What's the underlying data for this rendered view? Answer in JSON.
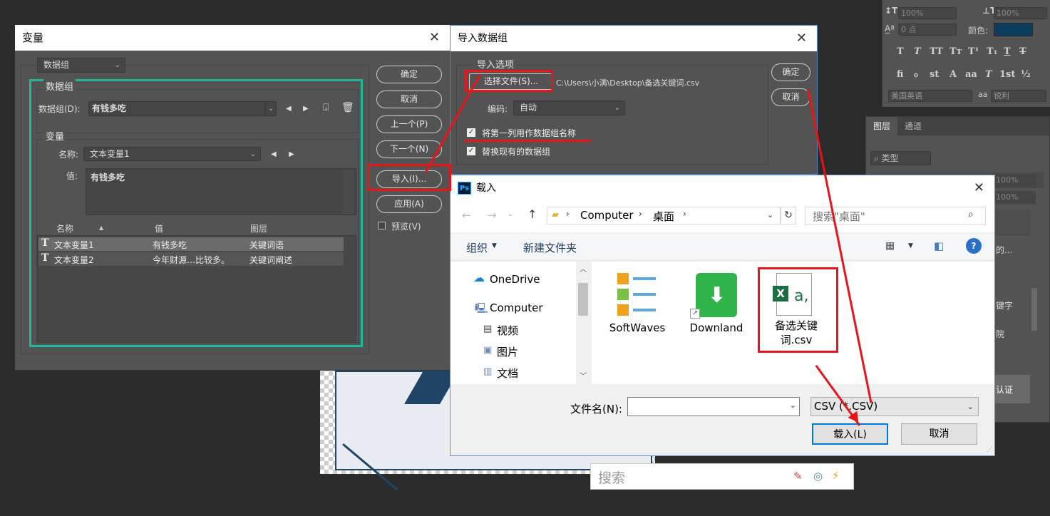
{
  "ps_char_panel": {
    "leading_value": "100%",
    "tracking_value": "100%",
    "baseline_value": "0 点",
    "color_label": "颜色:",
    "language": "美国英语",
    "aa_label": "aa",
    "aa_value": "锐利",
    "color_swatch": "#0a3d5e"
  },
  "ps_layers_panel": {
    "tab_layers": "图层",
    "tab_channels": "通道",
    "filter_label": "类型",
    "opacity1": "100%",
    "opacity2": "100%",
    "layer_frag1": "的...",
    "layer_frag2": "键字",
    "layer_frag3": "院",
    "layer_frag4": "认证"
  },
  "bottom_search_placeholder": "搜索",
  "variables_dialog": {
    "title": "变量",
    "mode_select": "数据组",
    "dataset_group_label": "数据组",
    "dataset_label": "数据组(D):",
    "dataset_value": "有钱多吃",
    "variables_group_label": "变量",
    "name_label": "名称:",
    "name_value": "文本变量1",
    "value_label": "值:",
    "value_text": "有钱多吃",
    "table_headers": [
      "名称",
      "值",
      "图层"
    ],
    "rows": [
      {
        "name": "文本变量1",
        "value": "有钱多吃",
        "layer": "关键词语"
      },
      {
        "name": "文本变量2",
        "value": "今年财源…比较多。",
        "layer": "关键词阐述"
      }
    ],
    "btn_ok": "确定",
    "btn_cancel": "取消",
    "btn_prev": "上一个(P)",
    "btn_next": "下一个(N)",
    "btn_import": "导入(I)...",
    "btn_apply": "应用(A)",
    "preview_label": "预览(V)"
  },
  "import_dialog": {
    "title": "导入数据组",
    "options_label": "导入选项",
    "choose_file_btn": "选择文件(S)...",
    "file_path": "C:\\Users\\小满\\Desktop\\备选关键词.csv",
    "encoding_label": "编码:",
    "encoding_value": "自动",
    "check1_label": "将第一列用作数据组名称",
    "check2_label": "替换现有的数据组",
    "btn_ok": "确定",
    "btn_cancel": "取消"
  },
  "load_dialog": {
    "title": "载入",
    "app_badge": "Ps",
    "breadcrumb": [
      "Computer",
      "桌面"
    ],
    "search_placeholder": "搜索\"桌面\"",
    "organize": "组织",
    "new_folder": "新建文件夹",
    "nav_items": [
      "OneDrive",
      "Computer",
      "视频",
      "图片",
      "文档"
    ],
    "files": [
      {
        "name": "SoftWaves"
      },
      {
        "name": "Downland"
      },
      {
        "name": "备选关键词.csv",
        "badge": "X"
      }
    ],
    "filename_label": "文件名(N):",
    "filename_value": "",
    "filetype_value": "CSV (*.CSV)",
    "btn_load": "载入(L)",
    "btn_cancel": "取消"
  }
}
